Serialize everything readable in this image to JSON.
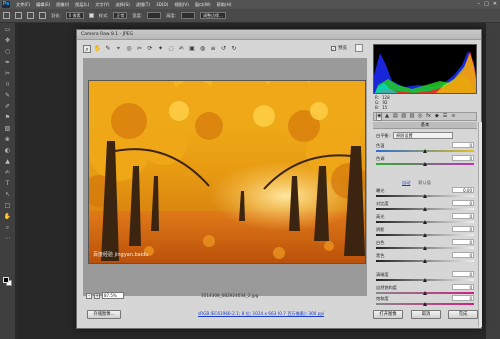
{
  "photoshop": {
    "logo": "Ps",
    "menu": [
      "文件(F)",
      "编辑(E)",
      "图像(I)",
      "图层(L)",
      "文字(Y)",
      "选择(S)",
      "滤镜(T)",
      "3D(D)",
      "视图(V)",
      "窗口(W)",
      "帮助(H)"
    ],
    "window_controls": [
      "–",
      "□",
      "✕"
    ],
    "options": {
      "feather_label": "羽化:",
      "feather_value": "0 像素",
      "style_label": "样式:",
      "style_value": "正常",
      "width_label": "宽度:",
      "height_label": "高度:",
      "refine_edge": "调整边缘..."
    },
    "tools": [
      "▭",
      "✥",
      "○",
      "✒",
      "✂",
      "⌑",
      "✎",
      "✐",
      "⚑",
      "▧",
      "❀",
      "◐",
      "▲",
      "✍",
      "T",
      "↖",
      "□",
      "✋",
      "⌕",
      "⋯"
    ]
  },
  "camera_raw": {
    "title": "Camera Raw 8.1 - JPEG",
    "toolbar_tools": [
      "⌕",
      "✋",
      "✎",
      "⌖",
      "◎",
      "✂",
      "⟳",
      "✦",
      "◌",
      "✍",
      "▣",
      "◍",
      "≡",
      "↺",
      "↻"
    ],
    "preview_label": "预览",
    "preview_checked": "✓",
    "rgb": {
      "r_label": "R:",
      "r": "128",
      "g_label": "G:",
      "g": "92",
      "b_label": "B:",
      "b": "15"
    },
    "tabs": [
      "◉",
      "▲",
      "▤",
      "▧",
      "▥",
      "◎",
      "fx",
      "◆",
      "☰",
      "≡"
    ],
    "panel_title": "基本",
    "white_balance": {
      "label": "白平衡:",
      "value": "原照设置"
    },
    "sliders": [
      {
        "label": "色温",
        "value": "0",
        "pos": 0.5,
        "track": "temp"
      },
      {
        "label": "色调",
        "value": "0",
        "pos": 0.5,
        "track": "tint"
      },
      {
        "label": "曝光",
        "value": "0.00",
        "pos": 0.5,
        "track": "gray"
      },
      {
        "label": "对比度",
        "value": "0",
        "pos": 0.5,
        "track": "gray"
      },
      {
        "label": "高光",
        "value": "0",
        "pos": 0.5,
        "track": "gray"
      },
      {
        "label": "阴影",
        "value": "0",
        "pos": 0.5,
        "track": "gray"
      },
      {
        "label": "白色",
        "value": "0",
        "pos": 0.5,
        "track": "gray"
      },
      {
        "label": "黑色",
        "value": "0",
        "pos": 0.5,
        "track": "gray"
      },
      {
        "label": "清晰度",
        "value": "0",
        "pos": 0.5,
        "track": "gray"
      },
      {
        "label": "自然饱和度",
        "value": "0",
        "pos": 0.5,
        "track": "vib"
      },
      {
        "label": "饱和度",
        "value": "0",
        "pos": 0.5,
        "track": "sat"
      }
    ],
    "auto_label": "自动",
    "default_label": "默认值",
    "zoom_value": "87.5%",
    "filename": "3514308_082924034_2.jpg",
    "workflow_link": "sRGB IEC61966-2.1; 8 位; 1024 x 663 (0.7 百万像素); 300 ppi",
    "watermark": "百度经验 jingyan.baidu",
    "buttons": {
      "save": "存储图像...",
      "open": "打开图像",
      "cancel": "取消",
      "done": "完成"
    }
  },
  "colors": {
    "slider_temp": [
      "#2a6fd6",
      "#e0c020"
    ],
    "slider_tint": [
      "#30b030",
      "#c030c0"
    ],
    "slider_gray": [
      "#222222",
      "#eeeeee"
    ],
    "slider_sat": [
      "#888888",
      "#d02080"
    ]
  }
}
